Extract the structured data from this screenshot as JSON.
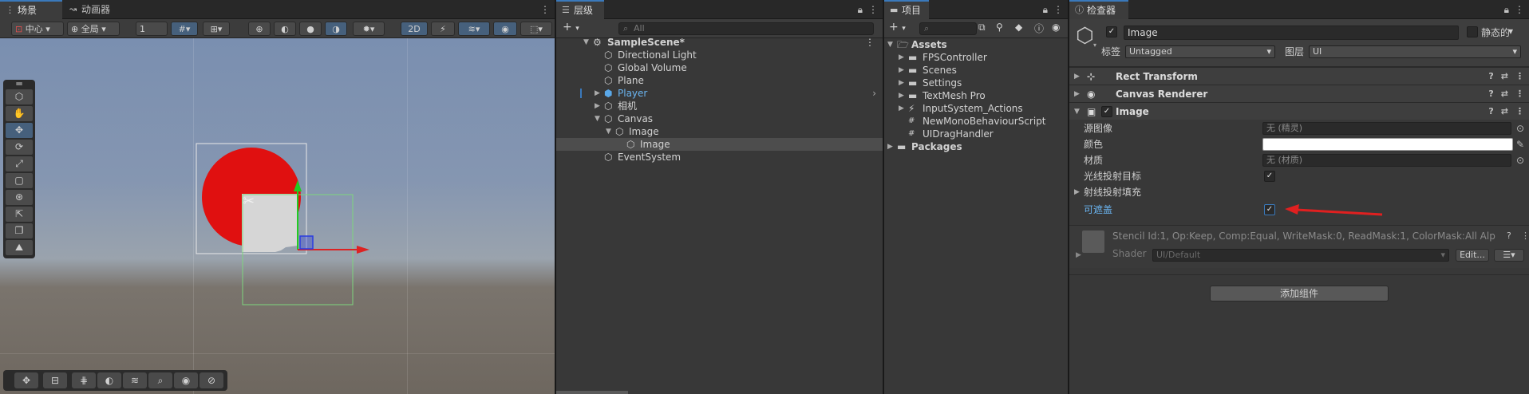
{
  "scene": {
    "tabs": [
      {
        "label": "场景",
        "icon": "grid-icon"
      },
      {
        "label": "动画器",
        "icon": "animator-icon"
      }
    ],
    "toolbar": {
      "pivot": "中心",
      "space": "全局",
      "snap_value": "1",
      "mode_2d": "2D"
    }
  },
  "hierarchy": {
    "tab": "层级",
    "search_placeholder": "All",
    "items": [
      {
        "label": "SampleScene*",
        "depth": 0,
        "icon": "unity-scene-icon",
        "expanded": true
      },
      {
        "label": "Directional Light",
        "depth": 1,
        "icon": "cube-icon"
      },
      {
        "label": "Global Volume",
        "depth": 1,
        "icon": "cube-icon"
      },
      {
        "label": "Plane",
        "depth": 1,
        "icon": "cube-icon"
      },
      {
        "label": "Player",
        "depth": 1,
        "icon": "prefab-icon",
        "collapsed": true,
        "prefab": true
      },
      {
        "label": "相机",
        "depth": 1,
        "icon": "cube-icon",
        "collapsed": true
      },
      {
        "label": "Canvas",
        "depth": 1,
        "icon": "cube-icon",
        "expanded": true
      },
      {
        "label": "Image",
        "depth": 2,
        "icon": "cube-icon",
        "expanded": true
      },
      {
        "label": "Image",
        "depth": 3,
        "icon": "cube-icon",
        "selected": true
      },
      {
        "label": "EventSystem",
        "depth": 1,
        "icon": "cube-icon"
      }
    ]
  },
  "project": {
    "tab": "项目",
    "items": [
      {
        "label": "Assets",
        "depth": 0,
        "icon": "folder-open-icon",
        "expanded": true
      },
      {
        "label": "FPSController",
        "depth": 1,
        "icon": "folder-icon"
      },
      {
        "label": "Scenes",
        "depth": 1,
        "icon": "folder-icon"
      },
      {
        "label": "Settings",
        "depth": 1,
        "icon": "folder-icon"
      },
      {
        "label": "TextMesh Pro",
        "depth": 1,
        "icon": "folder-icon"
      },
      {
        "label": "InputSystem_Actions",
        "depth": 1,
        "icon": "input-actions-icon"
      },
      {
        "label": "NewMonoBehaviourScript",
        "depth": 1,
        "icon": "csharp-script-icon"
      },
      {
        "label": "UIDragHandler",
        "depth": 1,
        "icon": "csharp-script-icon"
      },
      {
        "label": "Packages",
        "depth": 0,
        "icon": "folder-icon"
      }
    ]
  },
  "inspector": {
    "tab": "检查器",
    "object_name": "Image",
    "static_label": "静态的",
    "tag_label": "标签",
    "tag_value": "Untagged",
    "layer_label": "图层",
    "layer_value": "UI",
    "components": {
      "rect_transform": "Rect Transform",
      "canvas_renderer": "Canvas Renderer",
      "image": "Image"
    },
    "image_props": {
      "source_image_label": "源图像",
      "source_image_value": "无 (精灵)",
      "color_label": "颜色",
      "material_label": "材质",
      "material_value": "无 (材质)",
      "raycast_target_label": "光线投射目标",
      "raycast_padding_label": "射线投射填充",
      "maskable_label": "可遮盖"
    },
    "material_info": "Stencil Id:1, Op:Keep, Comp:Equal, WriteMask:0, ReadMask:1, ColorMask:All Alp",
    "shader_label": "Shader",
    "shader_value": "UI/Default",
    "edit_button": "Edit...",
    "add_component": "添加组件"
  },
  "colors": {
    "accent": "#3a79bb",
    "annotation_arrow": "#e02020",
    "circle_fill": "#e01010",
    "gizmo_green": "#22cc22",
    "gizmo_red": "#dd2222",
    "gizmo_blue": "#2a3de0"
  }
}
